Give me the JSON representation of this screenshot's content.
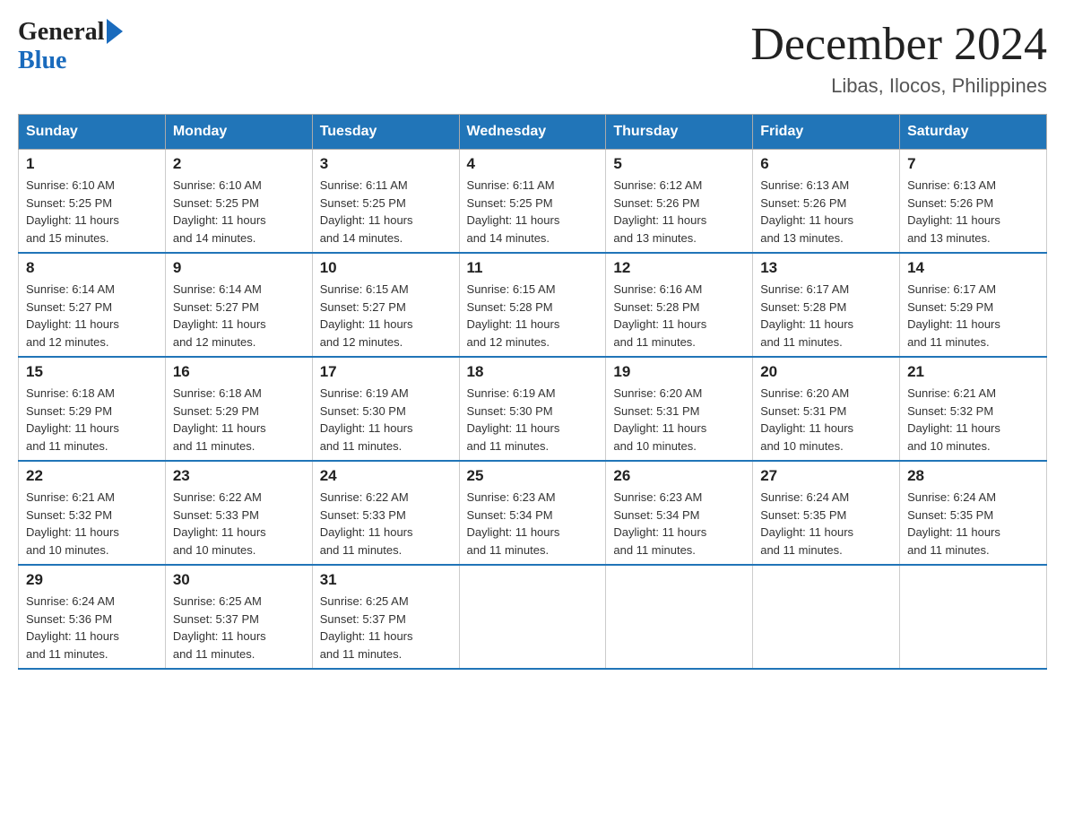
{
  "logo": {
    "general": "General",
    "blue": "Blue"
  },
  "title": "December 2024",
  "subtitle": "Libas, Ilocos, Philippines",
  "days_header": [
    "Sunday",
    "Monday",
    "Tuesday",
    "Wednesday",
    "Thursday",
    "Friday",
    "Saturday"
  ],
  "weeks": [
    [
      {
        "day": "1",
        "info": "Sunrise: 6:10 AM\nSunset: 5:25 PM\nDaylight: 11 hours\nand 15 minutes."
      },
      {
        "day": "2",
        "info": "Sunrise: 6:10 AM\nSunset: 5:25 PM\nDaylight: 11 hours\nand 14 minutes."
      },
      {
        "day": "3",
        "info": "Sunrise: 6:11 AM\nSunset: 5:25 PM\nDaylight: 11 hours\nand 14 minutes."
      },
      {
        "day": "4",
        "info": "Sunrise: 6:11 AM\nSunset: 5:25 PM\nDaylight: 11 hours\nand 14 minutes."
      },
      {
        "day": "5",
        "info": "Sunrise: 6:12 AM\nSunset: 5:26 PM\nDaylight: 11 hours\nand 13 minutes."
      },
      {
        "day": "6",
        "info": "Sunrise: 6:13 AM\nSunset: 5:26 PM\nDaylight: 11 hours\nand 13 minutes."
      },
      {
        "day": "7",
        "info": "Sunrise: 6:13 AM\nSunset: 5:26 PM\nDaylight: 11 hours\nand 13 minutes."
      }
    ],
    [
      {
        "day": "8",
        "info": "Sunrise: 6:14 AM\nSunset: 5:27 PM\nDaylight: 11 hours\nand 12 minutes."
      },
      {
        "day": "9",
        "info": "Sunrise: 6:14 AM\nSunset: 5:27 PM\nDaylight: 11 hours\nand 12 minutes."
      },
      {
        "day": "10",
        "info": "Sunrise: 6:15 AM\nSunset: 5:27 PM\nDaylight: 11 hours\nand 12 minutes."
      },
      {
        "day": "11",
        "info": "Sunrise: 6:15 AM\nSunset: 5:28 PM\nDaylight: 11 hours\nand 12 minutes."
      },
      {
        "day": "12",
        "info": "Sunrise: 6:16 AM\nSunset: 5:28 PM\nDaylight: 11 hours\nand 11 minutes."
      },
      {
        "day": "13",
        "info": "Sunrise: 6:17 AM\nSunset: 5:28 PM\nDaylight: 11 hours\nand 11 minutes."
      },
      {
        "day": "14",
        "info": "Sunrise: 6:17 AM\nSunset: 5:29 PM\nDaylight: 11 hours\nand 11 minutes."
      }
    ],
    [
      {
        "day": "15",
        "info": "Sunrise: 6:18 AM\nSunset: 5:29 PM\nDaylight: 11 hours\nand 11 minutes."
      },
      {
        "day": "16",
        "info": "Sunrise: 6:18 AM\nSunset: 5:29 PM\nDaylight: 11 hours\nand 11 minutes."
      },
      {
        "day": "17",
        "info": "Sunrise: 6:19 AM\nSunset: 5:30 PM\nDaylight: 11 hours\nand 11 minutes."
      },
      {
        "day": "18",
        "info": "Sunrise: 6:19 AM\nSunset: 5:30 PM\nDaylight: 11 hours\nand 11 minutes."
      },
      {
        "day": "19",
        "info": "Sunrise: 6:20 AM\nSunset: 5:31 PM\nDaylight: 11 hours\nand 10 minutes."
      },
      {
        "day": "20",
        "info": "Sunrise: 6:20 AM\nSunset: 5:31 PM\nDaylight: 11 hours\nand 10 minutes."
      },
      {
        "day": "21",
        "info": "Sunrise: 6:21 AM\nSunset: 5:32 PM\nDaylight: 11 hours\nand 10 minutes."
      }
    ],
    [
      {
        "day": "22",
        "info": "Sunrise: 6:21 AM\nSunset: 5:32 PM\nDaylight: 11 hours\nand 10 minutes."
      },
      {
        "day": "23",
        "info": "Sunrise: 6:22 AM\nSunset: 5:33 PM\nDaylight: 11 hours\nand 10 minutes."
      },
      {
        "day": "24",
        "info": "Sunrise: 6:22 AM\nSunset: 5:33 PM\nDaylight: 11 hours\nand 11 minutes."
      },
      {
        "day": "25",
        "info": "Sunrise: 6:23 AM\nSunset: 5:34 PM\nDaylight: 11 hours\nand 11 minutes."
      },
      {
        "day": "26",
        "info": "Sunrise: 6:23 AM\nSunset: 5:34 PM\nDaylight: 11 hours\nand 11 minutes."
      },
      {
        "day": "27",
        "info": "Sunrise: 6:24 AM\nSunset: 5:35 PM\nDaylight: 11 hours\nand 11 minutes."
      },
      {
        "day": "28",
        "info": "Sunrise: 6:24 AM\nSunset: 5:35 PM\nDaylight: 11 hours\nand 11 minutes."
      }
    ],
    [
      {
        "day": "29",
        "info": "Sunrise: 6:24 AM\nSunset: 5:36 PM\nDaylight: 11 hours\nand 11 minutes."
      },
      {
        "day": "30",
        "info": "Sunrise: 6:25 AM\nSunset: 5:37 PM\nDaylight: 11 hours\nand 11 minutes."
      },
      {
        "day": "31",
        "info": "Sunrise: 6:25 AM\nSunset: 5:37 PM\nDaylight: 11 hours\nand 11 minutes."
      },
      {
        "day": "",
        "info": ""
      },
      {
        "day": "",
        "info": ""
      },
      {
        "day": "",
        "info": ""
      },
      {
        "day": "",
        "info": ""
      }
    ]
  ]
}
